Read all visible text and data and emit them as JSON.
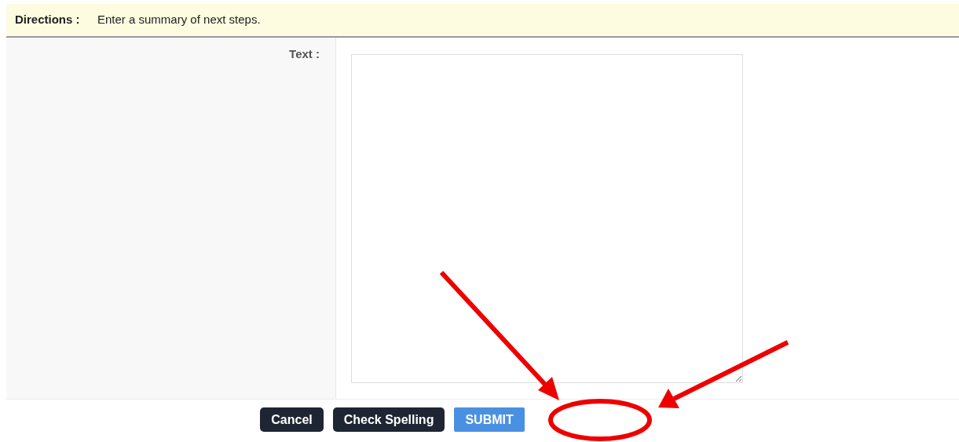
{
  "directions": {
    "label": "Directions :",
    "text": "Enter a summary of next steps."
  },
  "form": {
    "field_label": "Text :"
  },
  "buttons": [
    {
      "label": "Cancel",
      "kind": "secondary"
    },
    {
      "label": "Check Spelling",
      "kind": "secondary"
    },
    {
      "label": "SUBMIT",
      "kind": "primary"
    }
  ]
}
